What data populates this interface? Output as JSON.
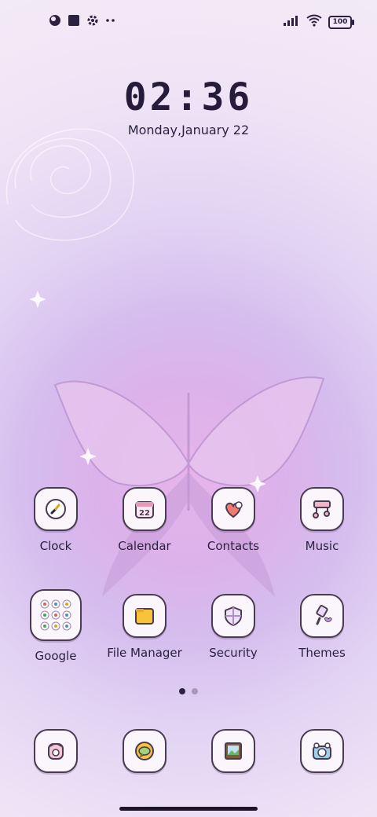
{
  "status_bar": {
    "left_icons": [
      "theme-circle-icon",
      "stop-square-icon",
      "settings-gear-icon",
      "more-dots-icon"
    ],
    "right_icons": [
      "cellular-signal-icon",
      "wifi-icon",
      "battery-icon"
    ],
    "battery_level": "100"
  },
  "clock_widget": {
    "time": "02:36",
    "date": "Monday,January 22"
  },
  "apps": [
    {
      "label": "Clock",
      "icon": "clock-icon"
    },
    {
      "label": "Calendar",
      "icon": "calendar-icon",
      "badge": "22"
    },
    {
      "label": "Contacts",
      "icon": "contacts-icon"
    },
    {
      "label": "Music",
      "icon": "music-icon"
    },
    {
      "label": "Google",
      "icon": "google-folder-icon"
    },
    {
      "label": "File Manager",
      "icon": "folder-icon"
    },
    {
      "label": "Security",
      "icon": "shield-icon"
    },
    {
      "label": "Themes",
      "icon": "paintbrush-icon"
    }
  ],
  "dock": [
    {
      "icon": "phone-icon"
    },
    {
      "icon": "message-icon"
    },
    {
      "icon": "gallery-icon"
    },
    {
      "icon": "camera-icon"
    }
  ],
  "page_indicator": {
    "pages": 2,
    "current": 1
  },
  "colors": {
    "accent": "#4a3a52",
    "text": "#2b2240",
    "background_center": "#e6b4ea"
  }
}
